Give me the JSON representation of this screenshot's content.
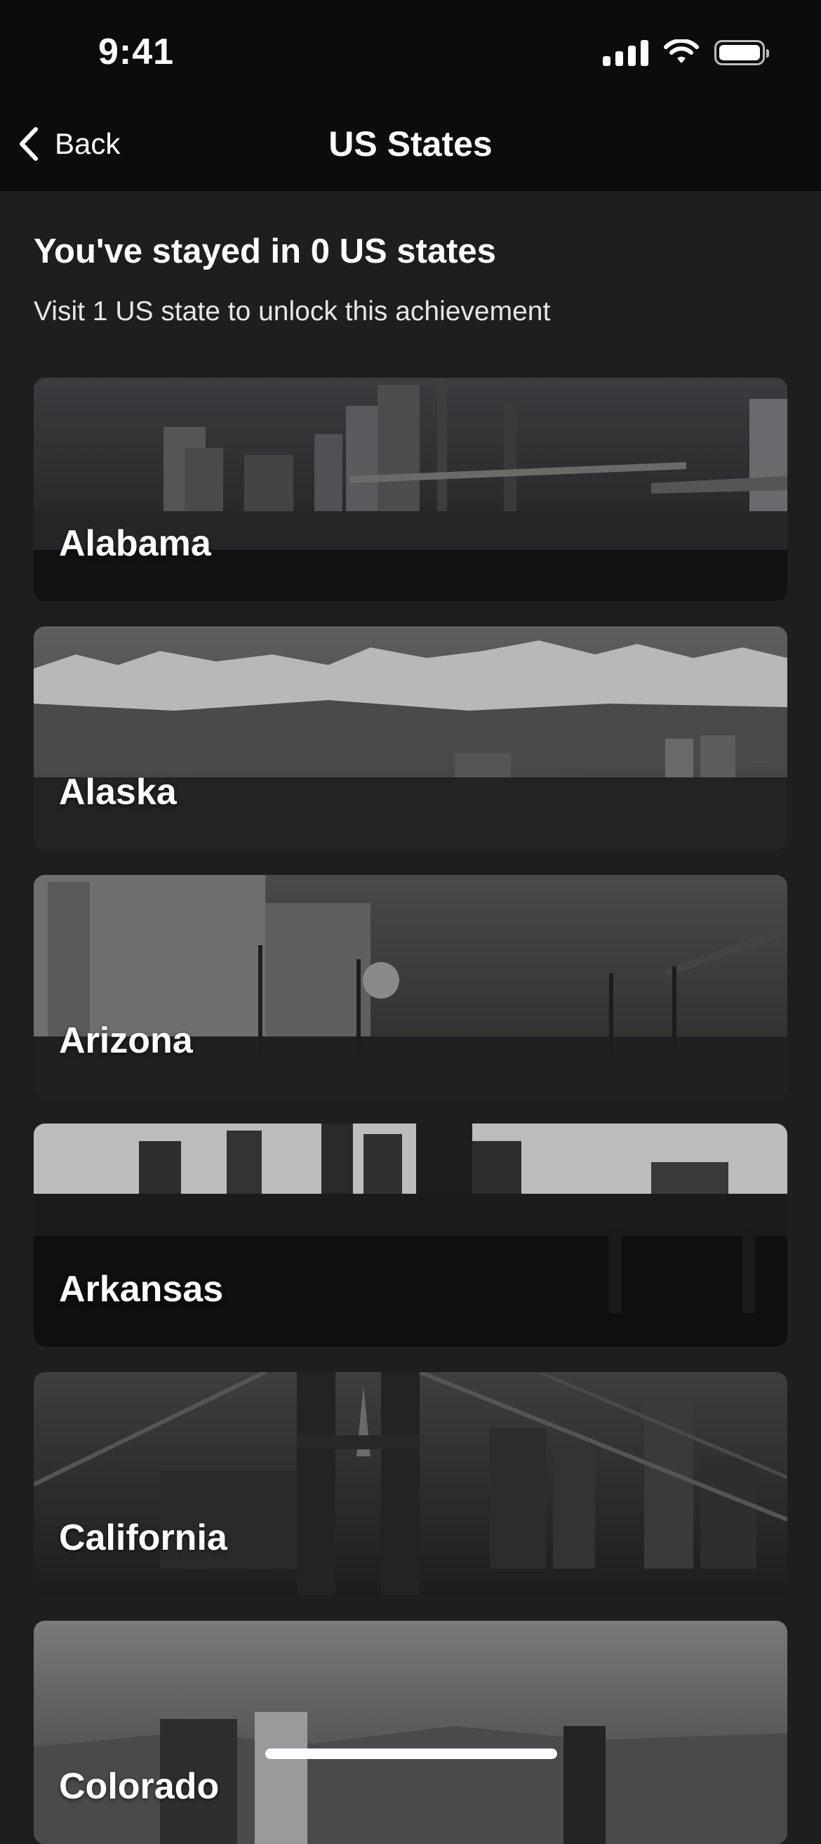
{
  "status_bar": {
    "time": "9:41",
    "icons": [
      "cellular-signal-icon",
      "wifi-icon",
      "battery-icon"
    ]
  },
  "nav": {
    "back_label": "Back",
    "title": "US States"
  },
  "summary": {
    "headline": "You've stayed in 0 US states",
    "subline": "Visit 1 US state to unlock this achievement"
  },
  "states": [
    {
      "name": "Alabama"
    },
    {
      "name": "Alaska"
    },
    {
      "name": "Arizona"
    },
    {
      "name": "Arkansas"
    },
    {
      "name": "California"
    },
    {
      "name": "Colorado"
    }
  ]
}
